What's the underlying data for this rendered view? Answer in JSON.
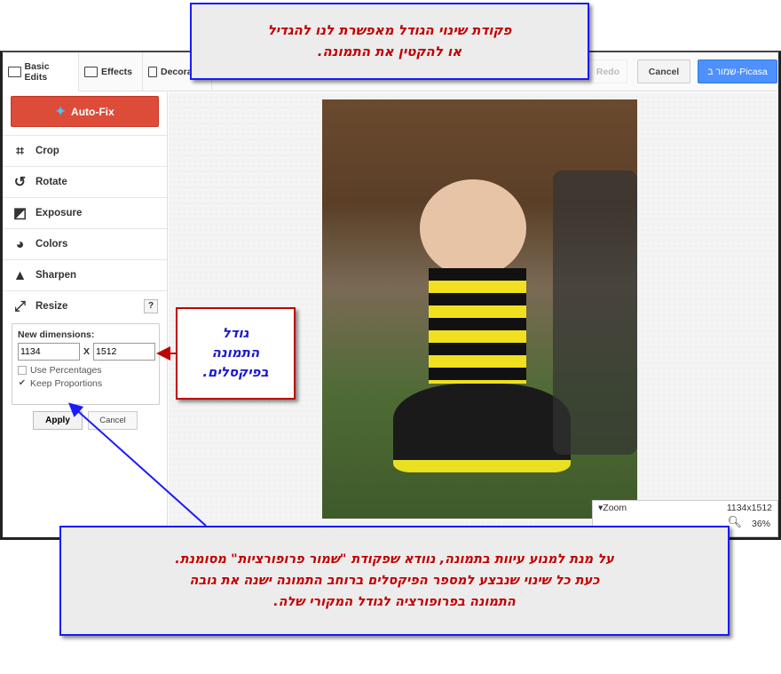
{
  "toolbar": {
    "tabs": [
      {
        "label": "Basic Edits",
        "icon": "photo-icon"
      },
      {
        "label": "Effects",
        "icon": "image-icon"
      },
      {
        "label": "Decora",
        "icon": "paint-roller-icon"
      }
    ],
    "redo": "Redo",
    "cancel": "Cancel",
    "save": "שמור ב-Picasa",
    "save_color": "#4d90fe"
  },
  "sidebar": {
    "autofix": "Auto-Fix",
    "autofix_color": "#dd4b39",
    "items": [
      {
        "label": "Crop",
        "icon": "crop-icon"
      },
      {
        "label": "Rotate",
        "icon": "rotate-icon"
      },
      {
        "label": "Exposure",
        "icon": "exposure-icon"
      },
      {
        "label": "Colors",
        "icon": "palette-icon"
      },
      {
        "label": "Sharpen",
        "icon": "sharpen-icon"
      },
      {
        "label": "Resize",
        "icon": "resize-icon"
      }
    ],
    "help": "?",
    "resize": {
      "label": "New dimensions:",
      "width": "1134",
      "x": "X",
      "height": "1512",
      "use_percentages": "Use Percentages",
      "use_percentages_checked": false,
      "keep_proportions": "Keep Proportions",
      "keep_proportions_checked": true,
      "apply": "Apply",
      "cancel": "Cancel"
    }
  },
  "zoom": {
    "label": "Zoom",
    "dimensions": "1134x1512",
    "percent": "36%"
  },
  "callouts": {
    "top_line1": "פקודת שינוי הגודל מאפשרת לנו להגדיל",
    "top_line2": "או להקטין את התמונה.",
    "side_line1": "גודל",
    "side_line2": "התמונה",
    "side_line3": "בפיקסלים.",
    "bottom_line1": "על מנת למנוע עיוות בתמונה, נוודא שפקודת \"שמור פרופורציות\" מסומנת.",
    "bottom_line2": "כעת כל שינוי שנבצע למספר הפיקסלים  ברוחב התמונה ישנה את גובה",
    "bottom_line3": "התמונה בפרופורציה לגודל המקורי שלה."
  }
}
